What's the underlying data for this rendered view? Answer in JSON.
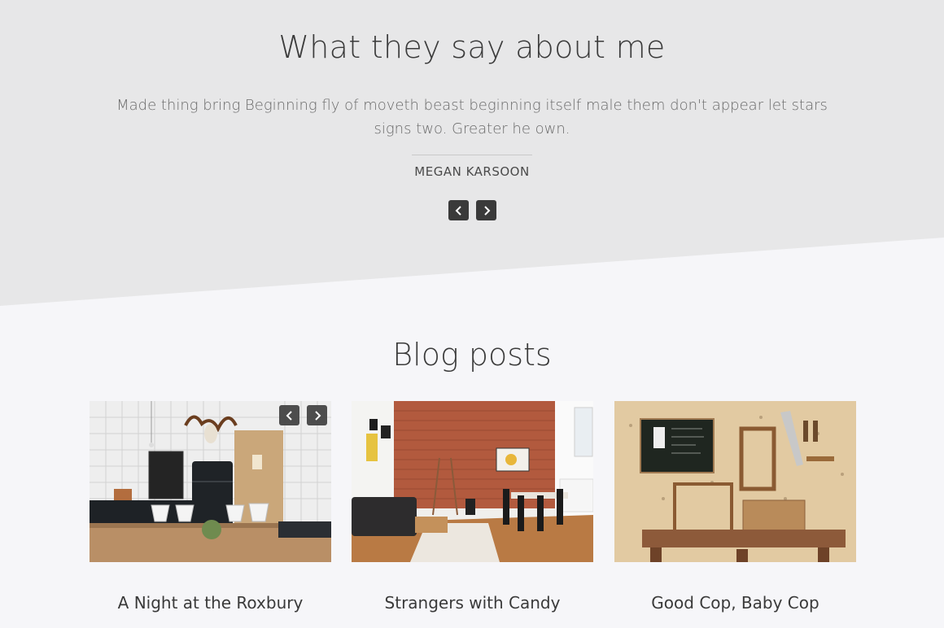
{
  "testimonial": {
    "heading": "What they say about me",
    "quote": "Made thing bring Beginning fly of moveth beast beginning itself male them don't appear let stars signs two. Greater he own.",
    "author": "MEGAN KARSOON",
    "prev_icon": "chevron-left-icon",
    "next_icon": "chevron-right-icon"
  },
  "blog": {
    "heading": "Blog posts",
    "posts": [
      {
        "title": "A Night at the Roxbury",
        "image": "kitchen-dining-photo"
      },
      {
        "title": "Strangers with Candy",
        "image": "brick-wall-living-room-photo"
      },
      {
        "title": "Good Cop, Baby Cop",
        "image": "plywood-workshop-photo"
      }
    ],
    "carousel_prev_icon": "chevron-left-icon",
    "carousel_next_icon": "chevron-right-icon"
  },
  "colors": {
    "testimonial_bg": "#e7e7e8",
    "page_bg": "#f6f6f9",
    "button_bg": "#3a3a3a",
    "text_dark": "#3b3b3b",
    "text_muted": "#6b6b6b"
  }
}
